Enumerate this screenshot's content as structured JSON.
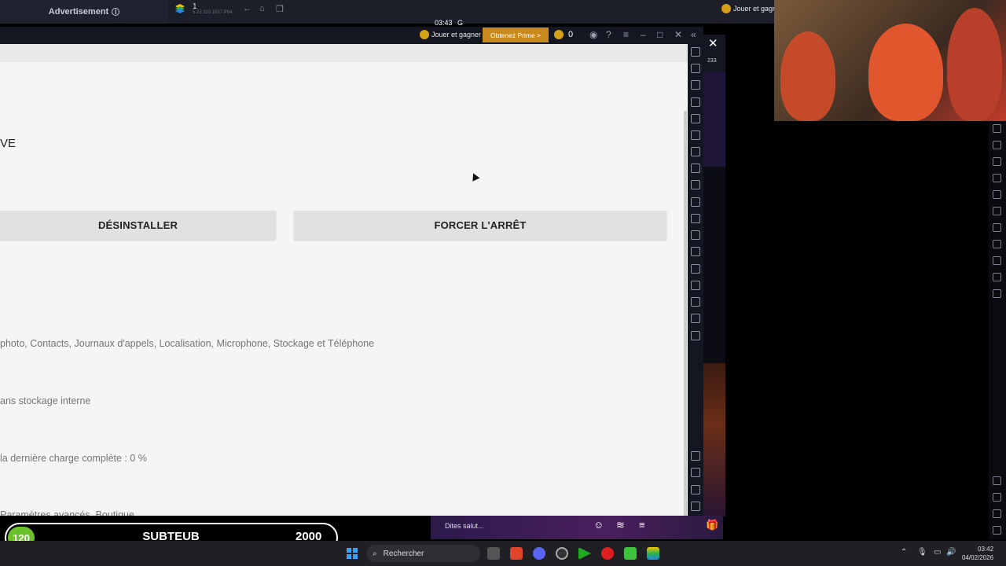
{
  "top_bar": {
    "advertisement": "Advertisement",
    "instance_name": "1",
    "instance_version": "5.22.110.1037 P64",
    "clock": "03:43",
    "jouer_label": "Jouer et gagn"
  },
  "emulator_bar": {
    "jouer_label": "Jouer et gagner",
    "prime_label": "Obtenez Prime >",
    "coins": "0",
    "notif_count": "233"
  },
  "settings_page": {
    "app_name_partial": "VE",
    "uninstall_button": "DÉSINSTALLER",
    "force_stop_button": "FORCER L'ARRÊT",
    "permissions_text": "photo, Contacts, Journaux d'appels, Localisation, Microphone, Stockage et Téléphone",
    "storage_text": "ans stockage interne",
    "battery_text": "la dernière charge complète : 0 %",
    "advanced_text": "Paramètres avancés, Boutique"
  },
  "chat_bar": {
    "say_hi": "Dites salut..."
  },
  "sub_goal": {
    "current": "120",
    "label": "SUBTEUB",
    "goal": "2000"
  },
  "taskbar": {
    "search_placeholder": "Rechercher",
    "time": "03:42",
    "date": "04/02/2026"
  },
  "colors": {
    "page_bg": "#f5f5f5",
    "button_bg": "#e1e1e1",
    "prime_orange": "#c98a1d",
    "sub_green": "#6ac22a",
    "taskbar_bg": "#1f1f24"
  }
}
